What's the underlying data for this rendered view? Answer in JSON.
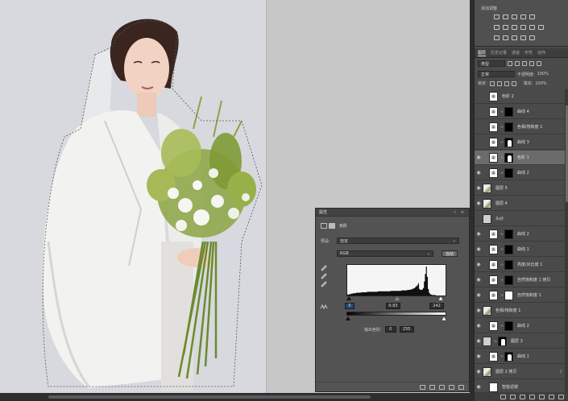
{
  "adjustments_panel": {
    "title": "添加调整"
  },
  "layers_panel": {
    "tabs": [
      "图层",
      "历史记录",
      "通道",
      "字符",
      "动作"
    ],
    "active_tab": 0,
    "filter_kind": "类型",
    "blend_mode": "正常",
    "opacity_label": "不透明度:",
    "opacity_value": "100%",
    "lock_label": "锁定:",
    "fill_label": "填充:",
    "fill_value": "100%",
    "layers": [
      {
        "name": "色阶 2",
        "thumb": "adj",
        "mask": "none",
        "visible": false,
        "indent": true
      },
      {
        "name": "曲线 4",
        "thumb": "adj",
        "mask": "black",
        "visible": false,
        "indent": true
      },
      {
        "name": "色相/饱和度 1",
        "thumb": "adj",
        "mask": "black",
        "visible": false,
        "indent": true
      },
      {
        "name": "曲线 3",
        "thumb": "adj",
        "mask": "silh",
        "visible": false,
        "indent": true
      },
      {
        "name": "色阶 1",
        "thumb": "adj",
        "mask": "silh",
        "visible": true,
        "indent": true,
        "selected": true
      },
      {
        "name": "曲线 2",
        "thumb": "adj",
        "mask": "black",
        "visible": true,
        "indent": true
      },
      {
        "name": "图层 5",
        "thumb": "photo",
        "mask": "none",
        "visible": true,
        "indent": false
      },
      {
        "name": "图层 4",
        "thumb": "photo",
        "mask": "none",
        "visible": true,
        "indent": false
      },
      {
        "name": "头纱",
        "thumb": "gray",
        "mask": "none",
        "visible": false,
        "indent": false
      },
      {
        "name": "曲线 2",
        "thumb": "adj",
        "mask": "black",
        "visible": true,
        "indent": true
      },
      {
        "name": "曲线 1",
        "thumb": "adj",
        "mask": "black",
        "visible": true,
        "indent": true
      },
      {
        "name": "亮度/对比度 1",
        "thumb": "adj",
        "mask": "black",
        "visible": true,
        "indent": true
      },
      {
        "name": "自然饱和度 1 拷贝",
        "thumb": "adj",
        "mask": "black",
        "visible": true,
        "indent": true
      },
      {
        "name": "自然饱和度 1",
        "thumb": "adj",
        "mask": "white",
        "visible": true,
        "indent": true
      },
      {
        "name": "色相/饱和度 1",
        "thumb": "photo",
        "mask": "none",
        "visible": true,
        "indent": false
      },
      {
        "name": "曲线 2",
        "thumb": "adj",
        "mask": "black",
        "visible": true,
        "indent": true
      },
      {
        "name": "图层 3",
        "thumb": "gray",
        "mask": "silh",
        "visible": true,
        "indent": false
      },
      {
        "name": "曲线 1",
        "thumb": "adj",
        "mask": "silh",
        "visible": true,
        "indent": true
      },
      {
        "name": "图层 2 拷贝",
        "thumb": "photo",
        "mask": "none",
        "visible": true,
        "indent": false,
        "fx": true
      },
      {
        "name": "智能滤镜",
        "thumb": "white",
        "mask": "none",
        "visible": true,
        "indent": true
      }
    ]
  },
  "properties_panel": {
    "title": "属性",
    "adjustment_name": "色阶",
    "preset_label": "预设:",
    "preset_value": "自定",
    "channel_value": "RGB",
    "auto_label": "自动",
    "input_black": "0",
    "input_gamma": "0.83",
    "input_white": "242",
    "output_label": "输出色阶:",
    "output_black": "0",
    "output_white": "255"
  },
  "histogram": [
    2,
    2,
    3,
    3,
    4,
    4,
    5,
    5,
    5,
    6,
    6,
    6,
    6,
    6,
    7,
    7,
    7,
    7,
    7,
    7,
    8,
    8,
    8,
    8,
    8,
    8,
    8,
    8,
    8,
    8,
    8,
    9,
    9,
    9,
    9,
    9,
    9,
    9,
    9,
    9,
    9,
    9,
    9,
    9,
    10,
    10,
    10,
    10,
    10,
    10,
    10,
    10,
    10,
    10,
    10,
    11,
    11,
    11,
    11,
    11,
    11,
    12,
    12,
    12,
    13,
    13,
    14,
    15,
    16,
    18,
    20,
    22,
    26,
    14,
    12,
    12,
    13,
    16,
    30,
    46,
    62,
    40,
    14,
    6,
    3,
    2,
    1,
    1,
    1,
    1,
    0,
    0,
    0,
    0,
    0,
    0,
    0,
    0,
    0,
    0
  ],
  "colors": {
    "canvas_background": "#d7d9de",
    "workspace": "#c7c7c7",
    "panel": "#4a4a4a",
    "selected_layer": "#6b6b6b",
    "active_input": "#21466d"
  }
}
